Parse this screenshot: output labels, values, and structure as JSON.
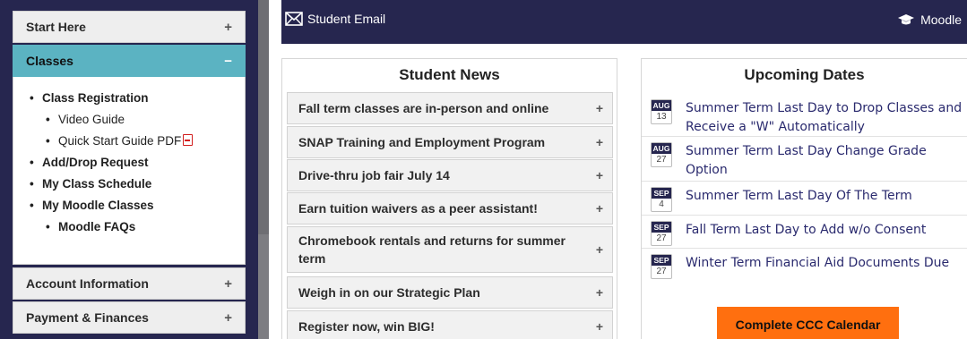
{
  "sidebar": {
    "sections": [
      {
        "label": "Start Here",
        "sign": "+"
      },
      {
        "label": "Classes",
        "sign": "−"
      },
      {
        "label": "Account Information",
        "sign": "+"
      },
      {
        "label": "Payment & Finances",
        "sign": "+"
      }
    ],
    "classes_items": [
      {
        "label": "Class Registration"
      },
      {
        "label": "Video Guide"
      },
      {
        "label": "Quick Start Guide PDF"
      },
      {
        "label": "Add/Drop Request"
      },
      {
        "label": "My Class Schedule"
      },
      {
        "label": "My Moodle Classes"
      },
      {
        "label": "Moodle FAQs"
      }
    ]
  },
  "topbar": {
    "email_label": "Student Email",
    "moodle_label": "Moodle"
  },
  "news": {
    "title": "Student News",
    "items": [
      {
        "label": "Fall term classes are in-person and online"
      },
      {
        "label": "SNAP Training and Employment Program"
      },
      {
        "label": "Drive-thru job fair July 14"
      },
      {
        "label": "Earn tuition waivers as a peer assistant!"
      },
      {
        "label": "Chromebook rentals and returns for summer term"
      },
      {
        "label": "Weigh in on our Strategic Plan"
      },
      {
        "label": "Register now, win BIG!"
      }
    ],
    "sign": "+"
  },
  "dates": {
    "title": "Upcoming Dates",
    "items": [
      {
        "month": "AUG",
        "day": "13",
        "text": "Summer Term Last Day to Drop Classes and Receive a \"W\" Automatically"
      },
      {
        "month": "AUG",
        "day": "27",
        "text": "Summer Term Last Day Change Grade Option"
      },
      {
        "month": "SEP",
        "day": "4",
        "text": "Summer Term Last Day Of The Term"
      },
      {
        "month": "SEP",
        "day": "27",
        "text": "Fall Term Last Day to Add w/o Consent"
      },
      {
        "month": "SEP",
        "day": "27",
        "text": "Winter Term Financial Aid Documents Due"
      }
    ],
    "button_label": "Complete CCC Calendar"
  },
  "colors": {
    "navy": "#26264f",
    "teal": "#5bb3c2",
    "orange": "#ff6f0f"
  }
}
